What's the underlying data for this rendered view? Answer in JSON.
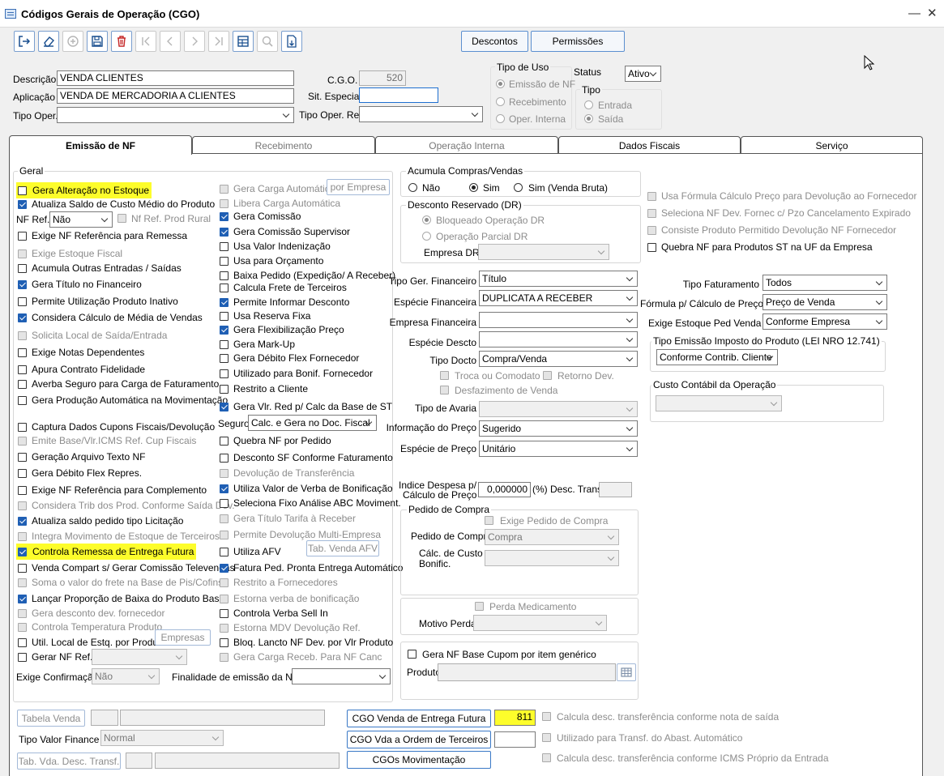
{
  "window": {
    "title": "Códigos Gerais de Operação (CGO)",
    "minimize": "—",
    "close": "✕"
  },
  "toolbar": {
    "descontos": "Descontos",
    "permissoes": "Permissões"
  },
  "header": {
    "descricao_label": "Descrição",
    "descricao_value": "VENDA CLIENTES",
    "aplicacao_label": "Aplicação",
    "aplicacao_value": "VENDA DE MERCADORIA A CLIENTES",
    "tipo_oper_label": "Tipo Oper.",
    "tipo_oper_value": "",
    "cgo_label": "C.G.O.",
    "cgo_value": "520",
    "sit_especial_label": "Sit. Especial",
    "sit_especial_value": "",
    "tipo_oper_rel_label": "Tipo Oper. Rel.",
    "tipo_oper_rel_value": "",
    "tipo_uso_label": "Tipo de Uso",
    "tipo_uso_options": [
      "Emissão de NF",
      "Recebimento",
      "Oper. Interna"
    ],
    "status_label": "Status",
    "status_value": "Ativo",
    "tipo_label": "Tipo",
    "tipo_options": [
      "Entrada",
      "Saída"
    ]
  },
  "tabs": [
    "Emissão de NF",
    "Recebimento",
    "Operação Interna",
    "Dados Fiscais",
    "Serviço"
  ],
  "geral": {
    "caption": "Geral",
    "col1": [
      "Gera Alteração no Estoque",
      "Atualiza Saldo de Custo Médio do Produto",
      "Exige NF Referência para Remessa",
      "Exige Estoque Fiscal",
      "Acumula Outras Entradas / Saídas",
      "Gera Título no Financeiro",
      "Permite Utilização Produto Inativo",
      "Considera Cálculo de Média de Vendas",
      "Solicita Local de Saída/Entrada",
      "Exige Notas Dependentes",
      "Apura Contrato Fidelidade",
      "Averba Seguro para Carga de Faturamento",
      "Gera Produção Automática na Movimentação",
      "Captura Dados Cupons Fiscais/Devolução",
      "Emite Base/Vlr.ICMS Ref. Cup Fiscais",
      "Geração Arquivo Texto NF",
      "Gera Débito Flex Repres.",
      "Exige NF Referência para Complemento",
      "Considera Trib dos Prod. Conforme Saída Dev.",
      "Atualiza saldo pedido tipo Licitação",
      "Integra Movimento de Estoque de Terceiros",
      "Controla Remessa de Entrega Futura",
      "Venda Compart s/ Gerar Comissão Televendas",
      "Soma o valor do frete na Base de Pis/Cofins",
      "Lançar Proporção de Baixa do Produto Base",
      "Gera desconto dev. fornecedor",
      "Controla Temperatura Produto",
      "Util. Local de Estq. por Produto",
      "Gerar NF Ref.:"
    ],
    "nf_ref_label": "NF Ref.",
    "nf_ref_value": "Não",
    "nf_ref_prod_rural": "Nf Ref. Prod Rural",
    "empresas_btn": "Empresas",
    "exige_confirmacao_label": "Exige Confirmação",
    "exige_confirmacao_value": "Não",
    "col2": [
      "Gera Carga Automática",
      "Libera Carga Automática",
      "Gera Comissão",
      "Gera Comissão Supervisor",
      "Usa Valor Indenização",
      "Usa para Orçamento",
      "Baixa Pedido (Expedição/ A Receber)",
      "Calcula Frete de Terceiros",
      "Permite Informar Desconto",
      "Usa Reserva Fixa",
      "Gera Flexibilização Preço",
      "Gera Mark-Up",
      "Gera Débito Flex Fornecedor",
      "Utilizado para Bonif. Fornecedor",
      "Restrito a Cliente",
      "Gera Vlr. Red p/ Calc da Base de ST",
      "Quebra NF por Pedido",
      "Desconto SF Conforme Faturamento",
      "Devolução de Transferência",
      "Utiliza Valor de Verba de Bonificação",
      "Seleciona Fixo Análise ABC Moviment.",
      "Gera Título Tarifa à Receber",
      "Permite Devolução Multi-Empresa",
      "Utiliza AFV",
      "Fatura Ped. Pronta Entrega Automático",
      "Restrito a Fornecedores",
      "Estorna verba de bonificação",
      "Controla Verba Sell In",
      "Estorna MDV Devolução Ref.",
      "Bloq. Lancto NF Dev. por Vlr Produto",
      "Gera Carga Receb. Para NF Canc"
    ],
    "por_empresa_btn": "por Empresa",
    "seguro_label": "Seguro",
    "seguro_value": "Calc. e Gera no Doc. Fiscal",
    "tab_venda_afv_btn": "Tab. Venda AFV",
    "finalidade_label": "Finalidade de emissão da NF-e",
    "finalidade_value": ""
  },
  "acumula": {
    "caption": "Acumula Compras/Vendas",
    "options": [
      "Não",
      "Sim",
      "Sim (Venda Bruta)"
    ]
  },
  "desconto_reservado": {
    "caption": "Desconto Reservado (DR)",
    "options": [
      "Bloqueado Operação DR",
      "Operação Parcial DR"
    ],
    "empresa_dr_label": "Empresa DR",
    "empresa_dr_value": ""
  },
  "financeiro": {
    "tipo_ger_label": "Tipo Ger. Financeiro",
    "tipo_ger_value": "Título",
    "especie_fin_label": "Espécie Financeira",
    "especie_fin_value": "DUPLICATA A RECEBER",
    "empresa_fin_label": "Empresa Financeira",
    "empresa_fin_value": "",
    "especie_descto_label": "Espécie Descto",
    "especie_descto_value": "",
    "tipo_docto_label": "Tipo Docto",
    "tipo_docto_value": "Compra/Venda",
    "troca_comodato": "Troca ou Comodato",
    "retorno_dev": "Retorno Dev.",
    "desfazimento": "Desfazimento de Venda",
    "tipo_avaria_label": "Tipo de Avaria",
    "tipo_avaria_value": "",
    "info_preco_label": "Informação do Preço",
    "info_preco_value": "Sugerido",
    "especie_preco_label": "Espécie de Preço",
    "especie_preco_value": "Unitário",
    "indice_label_1": "Indice Despesa p/",
    "indice_label_2": "Cálculo de Preço",
    "indice_value": "0,000000",
    "desc_transf_label": "(%) Desc. Transf.",
    "desc_transf_value": ""
  },
  "pedido_compra": {
    "caption": "Pedido de Compra",
    "exige": "Exige Pedido de Compra",
    "pedido_label": "Pedido de Compra",
    "pedido_value": "Compra",
    "calc_label_1": "Cálc. de Custo",
    "calc_label_2": "Bonific.",
    "calc_value": ""
  },
  "perda": {
    "perda_medicamento": "Perda Medicamento",
    "motivo_label": "Motivo Perda",
    "motivo_value": ""
  },
  "cupom": {
    "gera_nf_base": "Gera NF Base Cupom por item genérico",
    "produto_label": "Produto",
    "produto_value": ""
  },
  "right_checks": [
    "Usa Fórmula Cálculo Preço para Devolução ao Fornecedor",
    "Seleciona NF Dev. Fornec c/ Pzo Cancelamento Expirado",
    "Consiste Produto Permitido Devolução NF Fornecedor",
    "Quebra NF para Produtos ST na UF da Empresa"
  ],
  "faturamento": {
    "tipo_fat_label": "Tipo Faturamento",
    "tipo_fat_value": "Todos",
    "formula_label": "Fórmula p/ Cálculo de Preço",
    "formula_value": "Preço de Venda",
    "exige_estoque_label": "Exige Estoque Ped Venda",
    "exige_estoque_value": "Conforme Empresa",
    "tipo_emissao_caption": "Tipo Emissão Imposto do Produto (LEI NRO 12.741)",
    "tipo_emissao_value": "Conforme Contrib. Cliente",
    "custo_contabil_caption": "Custo Contábil da Operação",
    "custo_contabil_value": ""
  },
  "bottom": {
    "tabela_venda_btn": "Tabela Venda",
    "tipo_valor_label": "Tipo Valor Finance",
    "tipo_valor_value": "Normal",
    "tab_vda_desc_btn": "Tab. Vda. Desc. Transf.",
    "cgo_entrega_futura_btn": "CGO Venda de Entrega Futura",
    "cgo_entrega_futura_value": "811",
    "cgo_ordem_terceiros_btn": "CGO Vda a Ordem de Terceiros",
    "cgo_ordem_terceiros_value": "",
    "cgos_movimentacao_btn": "CGOs Movimentação",
    "checks": [
      "Calcula desc. transferência conforme nota de saída",
      "Utilizado para Transf. do Abast. Automático",
      "Calcula desc. transferência conforme ICMS Próprio da Entrada"
    ]
  },
  "colors": {
    "highlight": "#fdfd2b",
    "accent": "#1f5fb4"
  }
}
